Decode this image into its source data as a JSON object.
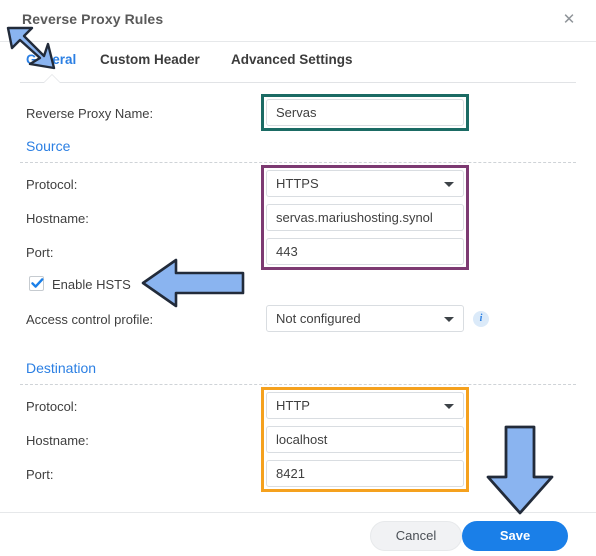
{
  "window": {
    "title": "Reverse Proxy Rules",
    "close_icon": "close-icon"
  },
  "tabs": [
    {
      "label": "General",
      "active": true
    },
    {
      "label": "Custom Header",
      "active": false
    },
    {
      "label": "Advanced Settings",
      "active": false
    }
  ],
  "form": {
    "name_row": {
      "label": "Reverse Proxy Name:",
      "value": "Servas"
    },
    "source": {
      "section_label": "Source",
      "protocol_label": "Protocol:",
      "protocol_value": "HTTPS",
      "hostname_label": "Hostname:",
      "hostname_value": "servas.mariushosting.synol",
      "port_label": "Port:",
      "port_value": "443",
      "hsts_label": "Enable HSTS",
      "hsts_checked": true,
      "acl_label": "Access control profile:",
      "acl_value": "Not configured",
      "acl_info_icon": "info-icon"
    },
    "destination": {
      "section_label": "Destination",
      "protocol_label": "Protocol:",
      "protocol_value": "HTTP",
      "hostname_label": "Hostname:",
      "hostname_value": "localhost",
      "port_label": "Port:",
      "port_value": "8421"
    }
  },
  "footer": {
    "cancel_label": "Cancel",
    "save_label": "Save"
  },
  "annotations": {
    "arrow_general": "arrow-down-right-icon",
    "arrow_hsts": "arrow-left-icon",
    "arrow_save": "arrow-down-icon",
    "highlight_name_color": "#1b6b64",
    "highlight_source_color": "#7d3a72",
    "highlight_destination_color": "#f5a11e"
  }
}
